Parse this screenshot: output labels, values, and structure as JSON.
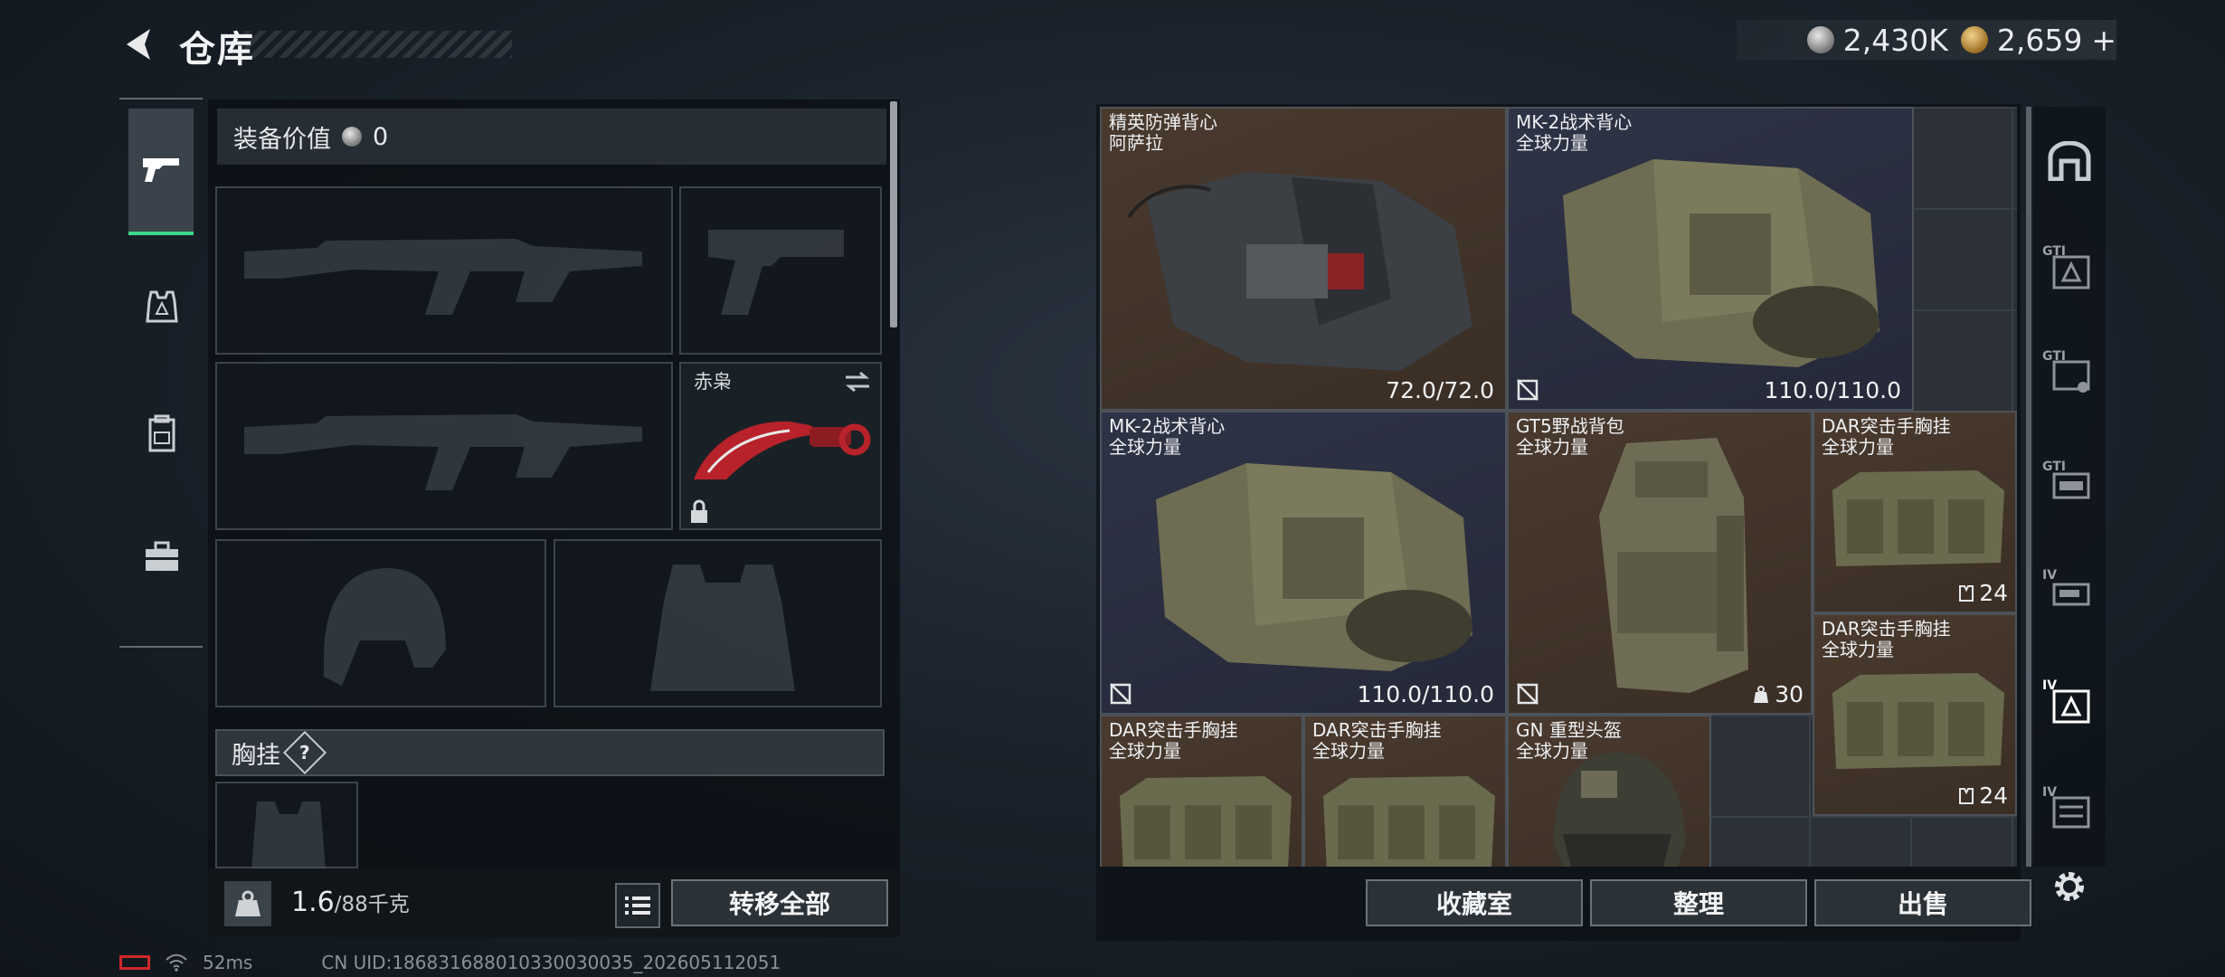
{
  "header": {
    "title": "仓库",
    "currencies": [
      {
        "icon": "silver-coin-icon",
        "value": "2,430K"
      },
      {
        "icon": "gold-coin-icon",
        "value": "2,659",
        "suffix": "+"
      }
    ]
  },
  "loadout": {
    "equipment_value_label": "装备价值",
    "equipment_value": "0",
    "knife_name": "赤枭",
    "chest_rig_label": "胸挂",
    "chest_rig_help": "?",
    "weight_current": "1.6",
    "weight_max": "/88千克",
    "transfer_all_label": "转移全部"
  },
  "inventory": {
    "items": [
      {
        "name": "精英防弹背心",
        "sub": "阿萨拉",
        "value": "72.0/72.0"
      },
      {
        "name": "MK-2战术背心",
        "sub": "全球力量",
        "value": "110.0/110.0"
      },
      {
        "name": "MK-2战术背心",
        "sub": "全球力量",
        "value": "110.0/110.0"
      },
      {
        "name": "GT5野战背包",
        "sub": "全球力量",
        "value": "30"
      },
      {
        "name": "DAR突击手胸挂",
        "sub": "全球力量",
        "value": "24"
      },
      {
        "name": "DAR突击手胸挂",
        "sub": "全球力量",
        "value": "24"
      },
      {
        "name": "DAR突击手胸挂",
        "sub": "全球力量"
      },
      {
        "name": "DAR突击手胸挂",
        "sub": "全球力量"
      },
      {
        "name": "GN 重型头盔",
        "sub": "全球力量"
      }
    ],
    "buttons": {
      "vault": "收藏室",
      "sort": "整理",
      "sell": "出售"
    }
  },
  "side_tabs": [
    "",
    "GTI",
    "GTI",
    "GTI",
    "IV",
    "IV",
    "IV"
  ],
  "footer": {
    "ping": "52ms",
    "uid": "CN UID:186831688010330030035_202605112051"
  }
}
